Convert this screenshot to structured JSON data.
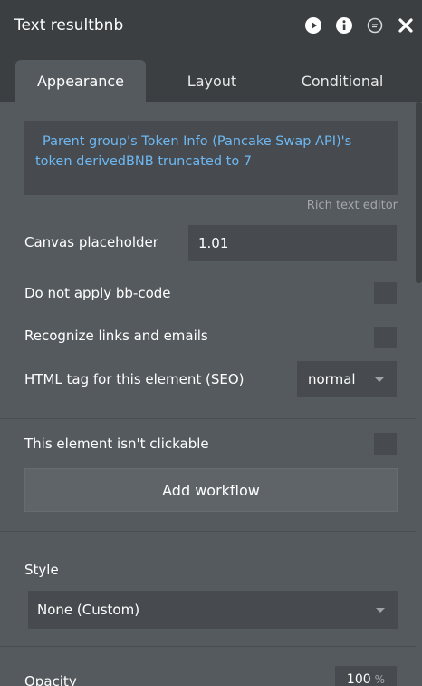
{
  "window": {
    "title": "Text resultbnb",
    "icons": [
      "play-icon",
      "info-icon",
      "comment-icon",
      "close-icon"
    ]
  },
  "tabs": [
    {
      "label": "Appearance",
      "active": true
    },
    {
      "label": "Layout",
      "active": false
    },
    {
      "label": "Conditional",
      "active": false
    }
  ],
  "content": {
    "expression": "Parent group's Token Info (Pancake Swap API)'s token derivedBNB truncated to 7",
    "rich_text_hint": "Rich text editor",
    "canvas_placeholder_label": "Canvas placeholder",
    "canvas_placeholder_value": "1.01",
    "no_bbcode_label": "Do not apply bb-code",
    "no_bbcode_checked": false,
    "recognize_links_label": "Recognize links and emails",
    "recognize_links_checked": false,
    "html_tag_label": "HTML tag for this element (SEO)",
    "html_tag_value": "normal",
    "not_clickable_label": "This element isn't clickable",
    "not_clickable_checked": false,
    "add_workflow_label": "Add workflow",
    "style_label": "Style",
    "style_value": "None (Custom)",
    "opacity_label": "Opacity",
    "opacity_value": "100",
    "opacity_unit": "%"
  },
  "colors": {
    "titlebar_bg": "#3b3f42",
    "panel_bg": "#555a5e",
    "field_bg": "#474b4f",
    "expression_text": "#6db8f2"
  }
}
